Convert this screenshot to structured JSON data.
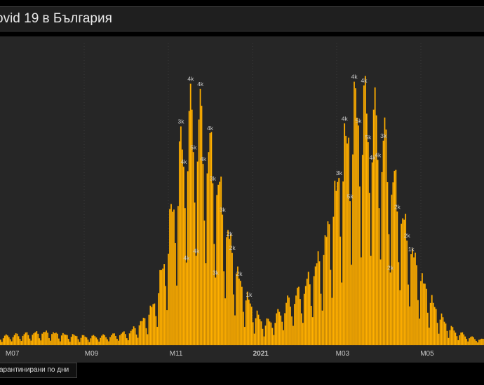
{
  "header": {
    "title": "ovid 19 в България"
  },
  "legend": {
    "label": "арантинирани по дни"
  },
  "colors": {
    "bar": "#ffb000",
    "bar_edge": "#d48a00",
    "background": "#262626",
    "grid": "#3a3a3a",
    "label": "#c8c8c8"
  },
  "chart_data": {
    "type": "bar",
    "title": "ovid 19 в България",
    "legend": [
      "арантинирани по дни"
    ],
    "grid": true,
    "x_ticks": [
      {
        "label": "M07",
        "index": 0,
        "bold": false
      },
      {
        "label": "M09",
        "index": 62,
        "bold": false
      },
      {
        "label": "M11",
        "index": 123,
        "bold": false
      },
      {
        "label": "2021",
        "index": 184,
        "bold": true
      },
      {
        "label": "M03",
        "index": 243,
        "bold": false
      },
      {
        "label": "M05",
        "index": 304,
        "bold": false
      }
    ],
    "start_index": -3,
    "ylim": [
      0,
      5600
    ],
    "weekly_profile": [
      1.05,
      1.1,
      1.12,
      1.0,
      0.65,
      0.38,
      0.85
    ],
    "keypoints": [
      [
        -3,
        150
      ],
      [
        15,
        200
      ],
      [
        30,
        230
      ],
      [
        45,
        180
      ],
      [
        60,
        150
      ],
      [
        75,
        170
      ],
      [
        90,
        230
      ],
      [
        100,
        450
      ],
      [
        108,
        750
      ],
      [
        115,
        1500
      ],
      [
        120,
        2300
      ],
      [
        126,
        3300
      ],
      [
        131,
        3900
      ],
      [
        136,
        4100
      ],
      [
        141,
        4000
      ],
      [
        146,
        3600
      ],
      [
        150,
        3300
      ],
      [
        155,
        2800
      ],
      [
        160,
        2100
      ],
      [
        165,
        1600
      ],
      [
        170,
        1100
      ],
      [
        175,
        850
      ],
      [
        180,
        600
      ],
      [
        185,
        450
      ],
      [
        190,
        420
      ],
      [
        195,
        500
      ],
      [
        200,
        650
      ],
      [
        205,
        800
      ],
      [
        210,
        900
      ],
      [
        215,
        1000
      ],
      [
        220,
        1200
      ],
      [
        225,
        1450
      ],
      [
        230,
        1750
      ],
      [
        235,
        2300
      ],
      [
        240,
        2900
      ],
      [
        245,
        3500
      ],
      [
        250,
        4100
      ],
      [
        255,
        4300
      ],
      [
        260,
        4250
      ],
      [
        265,
        4100
      ],
      [
        270,
        3900
      ],
      [
        275,
        3550
      ],
      [
        280,
        3000
      ],
      [
        285,
        2500
      ],
      [
        290,
        2000
      ],
      [
        295,
        1600
      ],
      [
        300,
        1250
      ],
      [
        305,
        950
      ],
      [
        310,
        700
      ],
      [
        315,
        500
      ],
      [
        320,
        350
      ],
      [
        325,
        250
      ],
      [
        330,
        200
      ],
      [
        335,
        150
      ],
      [
        340,
        120
      ],
      [
        345,
        100
      ]
    ],
    "peak_labels": [
      {
        "x": 127,
        "text": "3k"
      },
      {
        "x": 129,
        "text": "4k"
      },
      {
        "x": 131,
        "text": "4k"
      },
      {
        "x": 134,
        "text": "4k"
      },
      {
        "x": 136,
        "text": "5k"
      },
      {
        "x": 138,
        "text": "4k"
      },
      {
        "x": 141,
        "text": "4k"
      },
      {
        "x": 143,
        "text": "4k"
      },
      {
        "x": 148,
        "text": "4k"
      },
      {
        "x": 150,
        "text": "3k"
      },
      {
        "x": 152,
        "text": "3k"
      },
      {
        "x": 157,
        "text": "3k"
      },
      {
        "x": 162,
        "text": "2k"
      },
      {
        "x": 164,
        "text": "2k"
      },
      {
        "x": 169,
        "text": "2k"
      },
      {
        "x": 176,
        "text": "1k"
      },
      {
        "x": 241,
        "text": "3k"
      },
      {
        "x": 245,
        "text": "4k"
      },
      {
        "x": 249,
        "text": "5k"
      },
      {
        "x": 252,
        "text": "4k"
      },
      {
        "x": 255,
        "text": "5k"
      },
      {
        "x": 259,
        "text": "4k"
      },
      {
        "x": 262,
        "text": "5k"
      },
      {
        "x": 265,
        "text": "4k"
      },
      {
        "x": 269,
        "text": "4k"
      },
      {
        "x": 273,
        "text": "3k"
      },
      {
        "x": 278,
        "text": "2k"
      },
      {
        "x": 283,
        "text": "2k"
      },
      {
        "x": 290,
        "text": "2k"
      },
      {
        "x": 293,
        "text": "1k"
      }
    ]
  }
}
